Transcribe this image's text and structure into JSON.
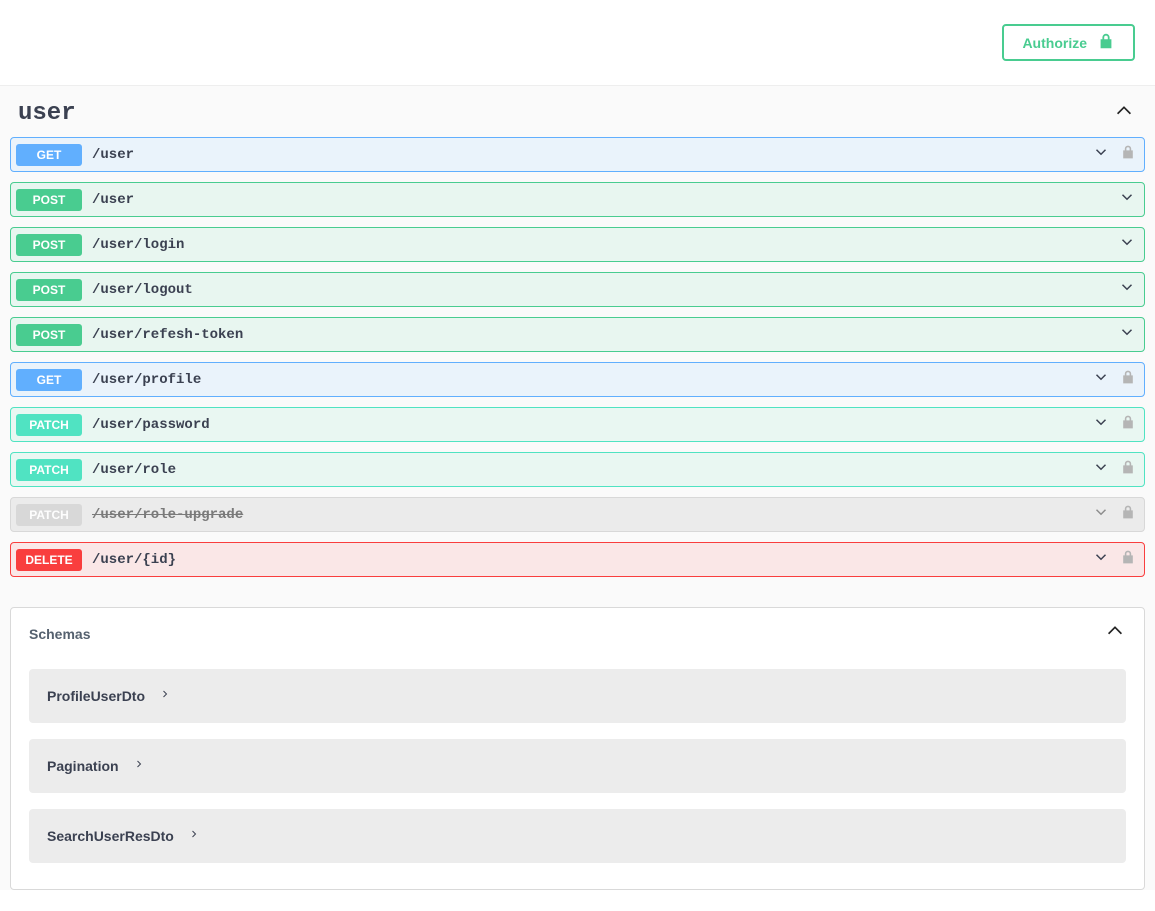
{
  "authorize": {
    "label": "Authorize"
  },
  "tag": {
    "name": "user"
  },
  "endpoints": [
    {
      "method": "GET",
      "path": "/user",
      "style": "get",
      "locked": true,
      "deprecated": false
    },
    {
      "method": "POST",
      "path": "/user",
      "style": "post",
      "locked": false,
      "deprecated": false
    },
    {
      "method": "POST",
      "path": "/user/login",
      "style": "post",
      "locked": false,
      "deprecated": false
    },
    {
      "method": "POST",
      "path": "/user/logout",
      "style": "post",
      "locked": false,
      "deprecated": false
    },
    {
      "method": "POST",
      "path": "/user/refesh-token",
      "style": "post",
      "locked": false,
      "deprecated": false
    },
    {
      "method": "GET",
      "path": "/user/profile",
      "style": "get",
      "locked": true,
      "deprecated": false
    },
    {
      "method": "PATCH",
      "path": "/user/password",
      "style": "patch",
      "locked": true,
      "deprecated": false
    },
    {
      "method": "PATCH",
      "path": "/user/role",
      "style": "patch",
      "locked": true,
      "deprecated": false
    },
    {
      "method": "PATCH",
      "path": "/user/role-upgrade",
      "style": "deprecated",
      "locked": true,
      "deprecated": true
    },
    {
      "method": "DELETE",
      "path": "/user/{id}",
      "style": "delete",
      "locked": true,
      "deprecated": false
    }
  ],
  "schemas": {
    "title": "Schemas",
    "items": [
      {
        "name": "ProfileUserDto"
      },
      {
        "name": "Pagination"
      },
      {
        "name": "SearchUserResDto"
      }
    ]
  }
}
